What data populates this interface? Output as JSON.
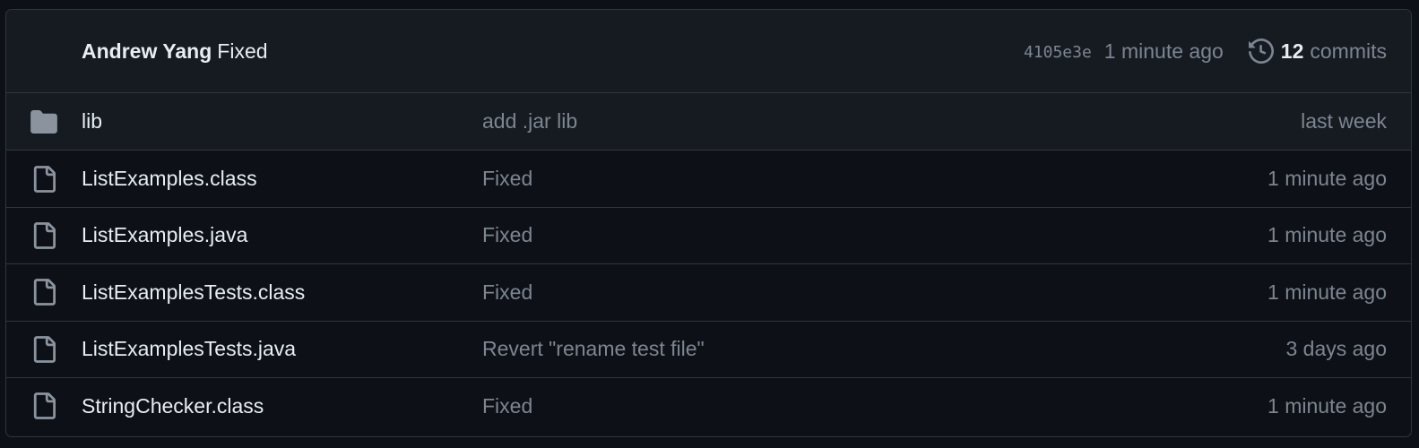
{
  "latest_commit": {
    "author": "Andrew Yang",
    "message": "Fixed",
    "sha": "4105e3e",
    "time": "1 minute ago",
    "commit_count": "12",
    "commits_label": "commits"
  },
  "files": [
    {
      "type": "folder",
      "icon": "folder-icon",
      "name": "lib",
      "message": "add .jar lib",
      "age": "last week"
    },
    {
      "type": "file",
      "icon": "file-icon",
      "name": "ListExamples.class",
      "message": "Fixed",
      "age": "1 minute ago"
    },
    {
      "type": "file",
      "icon": "file-icon",
      "name": "ListExamples.java",
      "message": "Fixed",
      "age": "1 minute ago"
    },
    {
      "type": "file",
      "icon": "file-icon",
      "name": "ListExamplesTests.class",
      "message": "Fixed",
      "age": "1 minute ago"
    },
    {
      "type": "file",
      "icon": "file-icon",
      "name": "ListExamplesTests.java",
      "message": "Revert \"rename test file\"",
      "age": "3 days ago"
    },
    {
      "type": "file",
      "icon": "file-icon",
      "name": "StringChecker.class",
      "message": "Fixed",
      "age": "1 minute ago"
    }
  ],
  "colors": {
    "background": "#0d1117",
    "header_bg": "#161b22",
    "border": "#30363d",
    "text": "#e6edf3",
    "muted": "#7d8590",
    "icon": "#8b949e"
  }
}
